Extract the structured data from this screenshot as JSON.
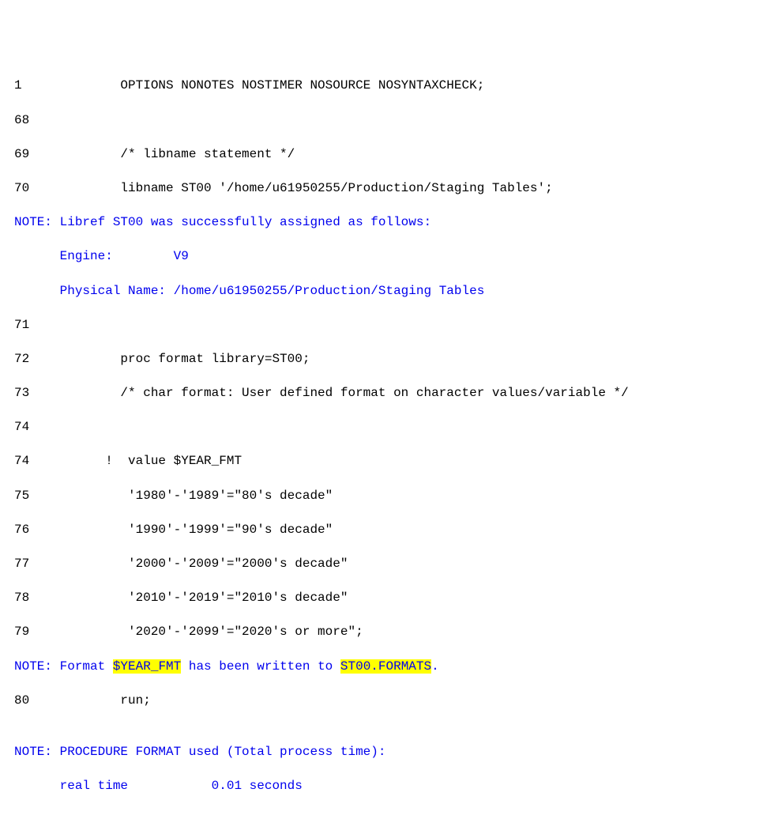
{
  "lines": {
    "l1_num": "1",
    "l1_code": "         OPTIONS NONOTES NOSTIMER NOSOURCE NOSYNTAXCHECK;",
    "l68_num": "68",
    "l68_code": "         ",
    "l69_num": "69",
    "l69_code": "         /* libname statement */",
    "l70_num": "70",
    "l70_code": "         libname ST00 '/home/u61950255/Production/Staging Tables';",
    "note1_a": "NOTE: Libref ST00 was successfully assigned as follows:",
    "note1_b": "      Engine:        V9",
    "note1_c": "      Physical Name: /home/u61950255/Production/Staging Tables",
    "l71_num": "71",
    "l71_code": "         ",
    "l72_num": "72",
    "l72_code": "         proc format library=ST00;",
    "l73_num": "73",
    "l73_code": "         /* char format: User defined format on character values/variable */",
    "l74a_num": "74",
    "l74a_code": "         ",
    "l74b_num": "74",
    "l74b_code": "       !  value $YEAR_FMT",
    "l75_num": "75",
    "l75_code": "          '1980'-'1989'=\"80's decade\"",
    "l76_num": "76",
    "l76_code": "          '1990'-'1999'=\"90's decade\"",
    "l77_num": "77",
    "l77_code": "          '2000'-'2009'=\"2000's decade\"",
    "l78_num": "78",
    "l78_code": "          '2010'-'2019'=\"2010's decade\"",
    "l79_num": "79",
    "l79_code": "          '2020'-'2099'=\"2020's or more\";",
    "note2_pre": "NOTE: Format ",
    "note2_hl1": "$YEAR_FMT",
    "note2_mid": " has been written to ",
    "note2_hl2": "ST00.FORMATS",
    "note2_end": ".",
    "l80_num": "80",
    "l80_code": "         run;",
    "blank": "",
    "note3_a": "NOTE: PROCEDURE FORMAT used (Total process time):",
    "note3_b": "      real time           0.01 seconds"
  }
}
